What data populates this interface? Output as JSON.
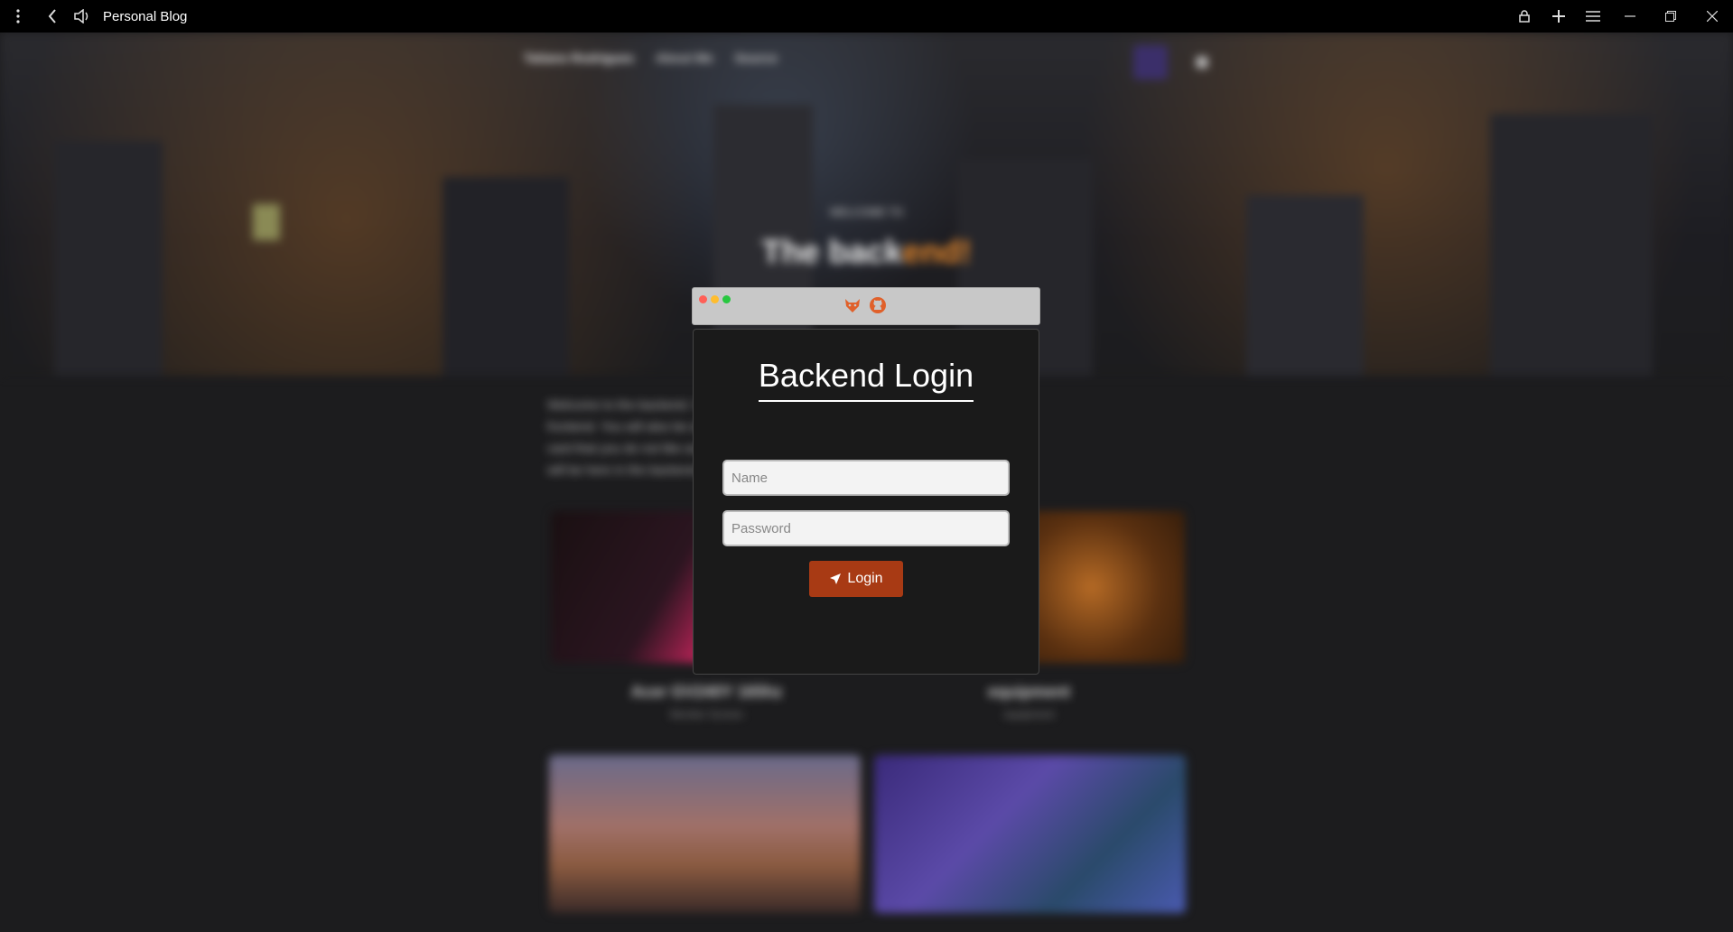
{
  "browser": {
    "title": "Personal Blog"
  },
  "page": {
    "nav": {
      "brand": "Tatiano Rodrigues",
      "about": "About Me",
      "source": "Source"
    },
    "hero": {
      "welcome": "WELCOME TO",
      "title_start": "The back",
      "title_accent": "end!"
    },
    "intro_lines": [
      "Welcome to the backend. Here you can edit the cards which are shown in the",
      "frontend. You will also be able to add new cards and, delete every",
      "card that you do not like anymore. There will be many more features that",
      "will be here in the backend soon."
    ],
    "cards": [
      {
        "title": "Acer GV240Y 165hz",
        "subtitle": "Monitor Screen"
      },
      {
        "title": "equipment",
        "subtitle": "equipment"
      }
    ]
  },
  "modal": {
    "title": "Backend Login",
    "name_placeholder": "Name",
    "password_placeholder": "Password",
    "login_label": "Login",
    "colors": {
      "accent": "#a83a14",
      "icon": "#e0602a"
    }
  }
}
